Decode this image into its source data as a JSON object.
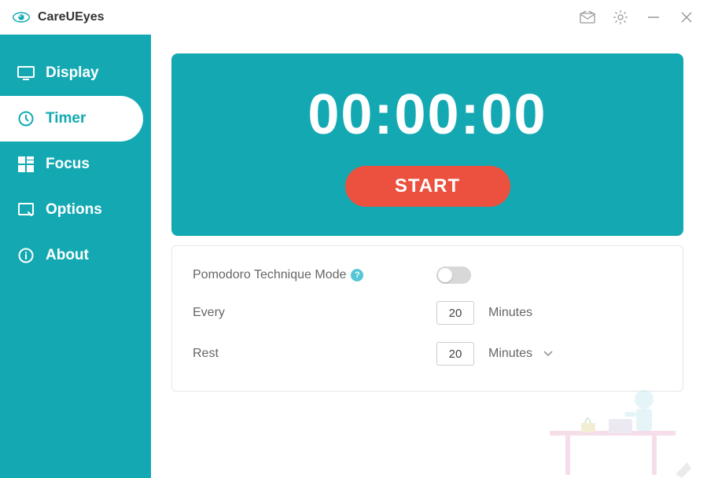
{
  "app": {
    "title": "CareUEyes"
  },
  "sidebar": {
    "items": [
      {
        "label": "Display"
      },
      {
        "label": "Timer"
      },
      {
        "label": "Focus"
      },
      {
        "label": "Options"
      },
      {
        "label": "About"
      }
    ],
    "activeIndex": 1
  },
  "timer": {
    "display": "00:00:00",
    "startLabel": "START"
  },
  "settings": {
    "pomodoro": {
      "label": "Pomodoro Technique Mode",
      "enabled": false
    },
    "every": {
      "label": "Every",
      "value": "20",
      "unit": "Minutes"
    },
    "rest": {
      "label": "Rest",
      "value": "20",
      "unit": "Minutes"
    }
  }
}
